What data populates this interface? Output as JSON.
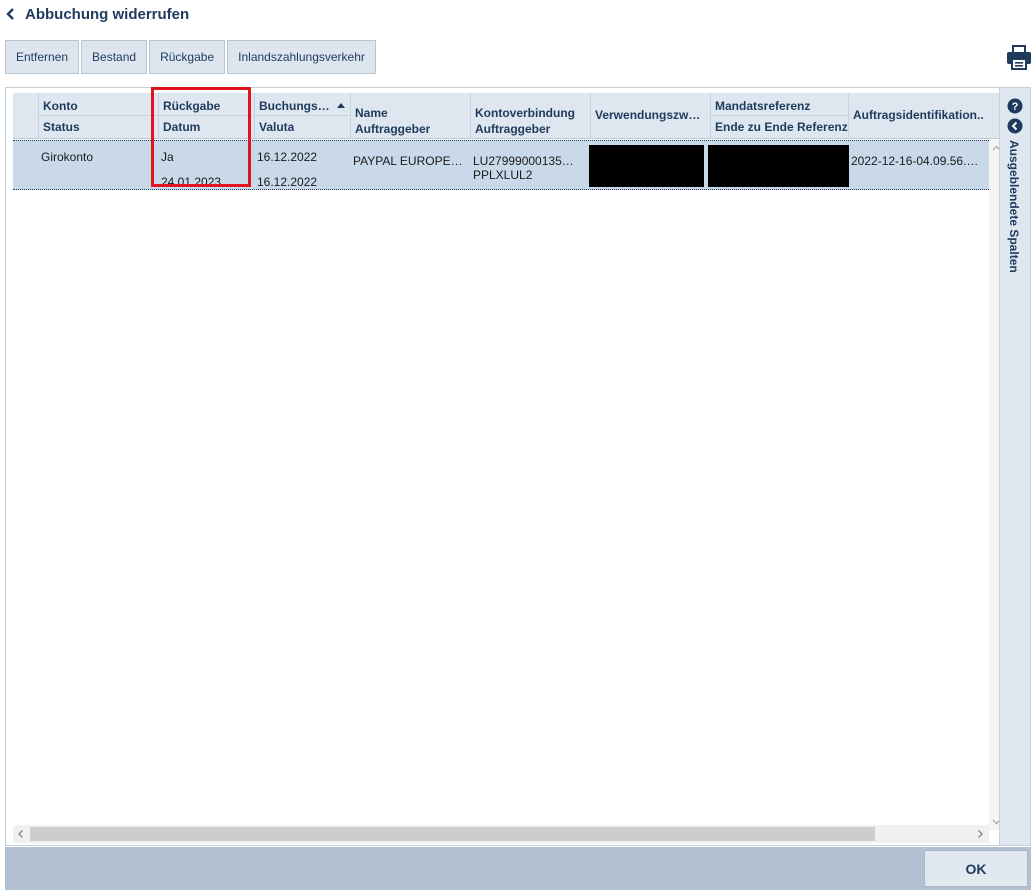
{
  "page": {
    "title": "Abbuchung widerrufen"
  },
  "toolbar": {
    "buttons": [
      "Entfernen",
      "Bestand",
      "Rückgabe",
      "Inlandszahlungsverkehr"
    ]
  },
  "grid": {
    "columns": {
      "konto": "Konto",
      "status": "Status",
      "rueckgabe": "Rückgabe",
      "datum": "Datum",
      "buchung": "Buchungs…",
      "valuta": "Valuta",
      "name": "Name",
      "auftraggeber": "Auftraggeber",
      "kontoverbindung": "Kontoverbindung",
      "kontoverbindung_auftraggeber": "Auftraggeber",
      "verwendungszweck": "Verwendungszw…",
      "mandatsreferenz": "Mandatsreferenz",
      "e2e": "Ende zu Ende Referenz",
      "auftragsid": "Auftragsidentifikation.."
    },
    "rows": [
      {
        "konto": "Girokonto",
        "rueckgabe": "Ja",
        "datum": "24.01.2023",
        "buchung": "16.12.2022",
        "valuta": "16.12.2022",
        "name": "PAYPAL EUROPE…",
        "iban": "LU27999000135…",
        "bic": "PPLXLUL2",
        "auftragsid": "2022-12-16-04.09.56.…"
      }
    ]
  },
  "side_panel": {
    "label": "Ausgeblendete Spalten"
  },
  "footer": {
    "ok_label": "OK"
  },
  "colors": {
    "accent": "#1e3a5c",
    "highlight": "#e0141c",
    "selection": "#c9d9ea"
  }
}
